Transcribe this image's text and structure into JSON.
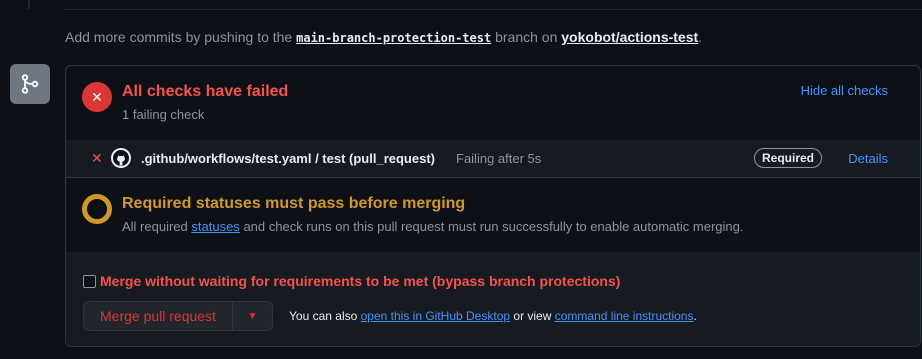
{
  "push_line": {
    "prefix": "Add more commits by pushing to the",
    "branch": "main-branch-protection-test",
    "middle": "branch on",
    "repo": "yokobot/actions-test",
    "suffix": "."
  },
  "checks": {
    "title": "All checks have failed",
    "subtitle": "1 failing check",
    "hide_link": "Hide all checks",
    "item": {
      "name": ".github/workflows/test.yaml / test (pull_request)",
      "status": "Failing after 5s",
      "badge": "Required",
      "details": "Details"
    }
  },
  "required": {
    "title": "Required statuses must pass before merging",
    "text_before": "All required",
    "link": "statuses",
    "text_after": "and check runs on this pull request must run successfully to enable automatic merging."
  },
  "merge": {
    "bypass_label": "Merge without waiting for requirements to be met (bypass branch protections)",
    "button_label": "Merge pull request",
    "also_prefix": "You can also",
    "desktop_link": "open this in GitHub Desktop",
    "or_view": "or view",
    "cli_link": "command line instructions",
    "suffix": "."
  },
  "icons": {
    "merge": "git-merge-icon",
    "fail": "x-icon",
    "github": "github-logo-icon",
    "pending": "pending-ring-icon",
    "dropdown": "triangle-down-icon"
  },
  "colors": {
    "fail": "#f85149",
    "pending": "#d29922",
    "link": "#4493f8"
  }
}
